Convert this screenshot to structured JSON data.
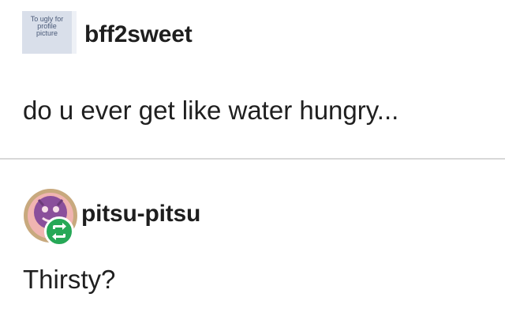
{
  "posts": [
    {
      "username": "bff2sweet",
      "avatar_text": [
        "To ugly for",
        "profile",
        "picture"
      ],
      "body": "do u ever get like water hungry..."
    },
    {
      "username": "pitsu-pitsu",
      "avatar": "pitsu-avatar",
      "badge_icon": "reblog-icon",
      "body": "Thirsty?"
    }
  ],
  "colors": {
    "divider": "#d8d8d8",
    "reblog_badge": "#26a857",
    "avatar_bg": "#d9dfea"
  }
}
